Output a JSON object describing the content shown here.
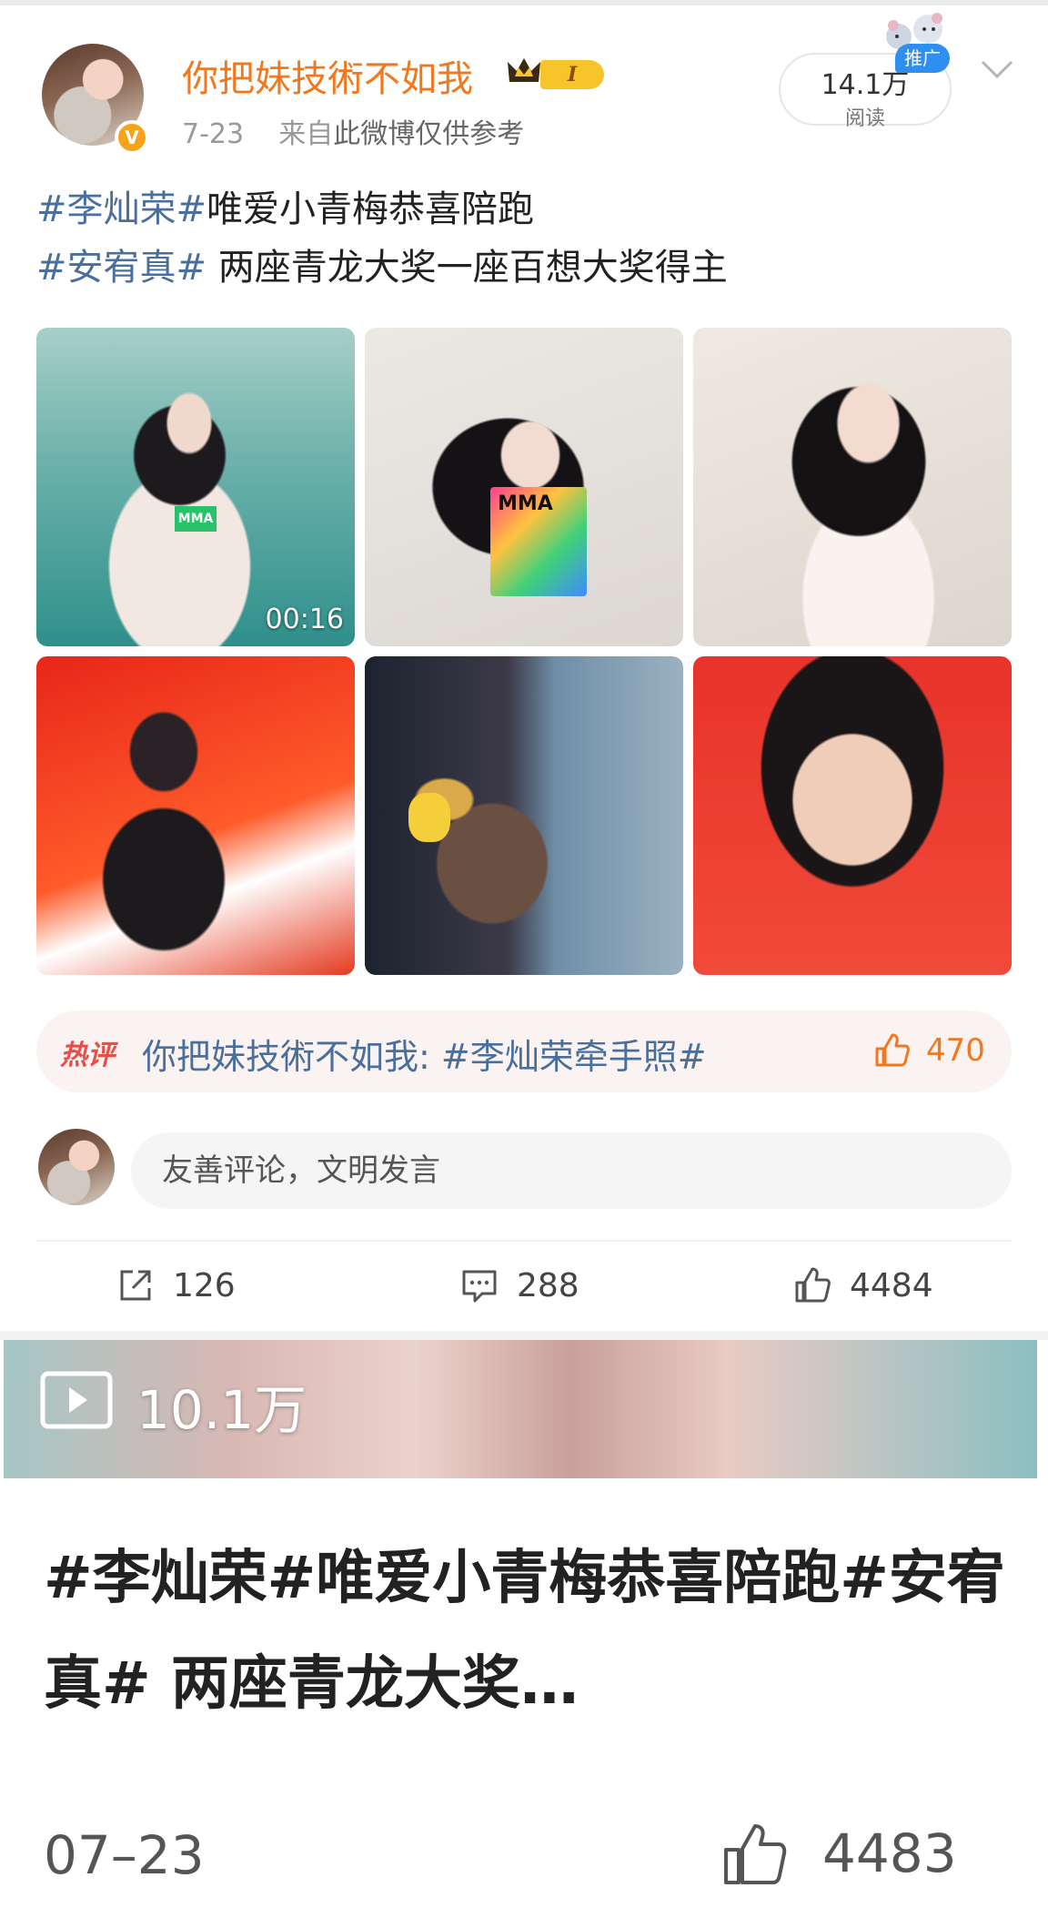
{
  "post": {
    "author": "你把妹技術不如我",
    "level_badge": "I",
    "verified_mark": "V",
    "date": "7-23",
    "source_prefix": "来自",
    "source": "此微博仅供参考",
    "read_count": "14.1万",
    "read_label": "阅读",
    "promo_badge": "推广",
    "text_line1_tag": "#李灿荣#",
    "text_line1_rest": "唯爱小青梅恭喜陪跑",
    "text_line2_tag": "#安宥真#",
    "text_line2_rest": " 两座青龙大奖一座百想大奖得主",
    "video_duration": "00:16",
    "mma_label": "MMA",
    "accent_color": "#f0781f",
    "link_color": "#4a6f9c"
  },
  "hot_comment": {
    "label": "热评",
    "text": "你把妹技術不如我: #李灿荣牵手照#",
    "like_count": "470",
    "icon": "thumbs-up-icon"
  },
  "comment_box": {
    "placeholder": "友善评论，文明发言"
  },
  "actions": {
    "repost_count": "126",
    "comment_count": "288",
    "like_count": "4484"
  },
  "card": {
    "play_count": "10.1万",
    "title": "#李灿荣#唯爱小青梅恭喜陪跑#安宥真# 两座青龙大奖…",
    "date": "07–23",
    "like_count": "4483"
  }
}
